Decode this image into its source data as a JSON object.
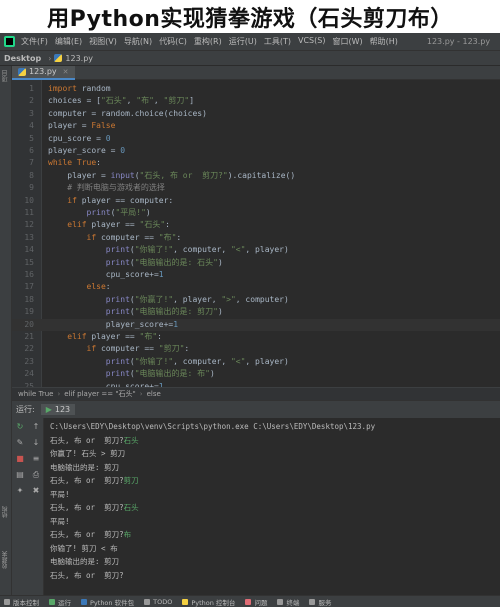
{
  "banner": {
    "title": "用Python实现猜拳游戏（石头剪刀布）"
  },
  "menubar": {
    "items": [
      "文件(F)",
      "编辑(E)",
      "视图(V)",
      "导航(N)",
      "代码(C)",
      "重构(R)",
      "运行(U)",
      "工具(T)",
      "VCS(S)",
      "窗口(W)",
      "帮助(H)"
    ],
    "window_title": "123.py - 123.py"
  },
  "navbar": {
    "root": "Desktop",
    "file": "123.py"
  },
  "editor": {
    "tab_label": "123.py",
    "current_line": 20,
    "lines": [
      [
        [
          "kw",
          "import "
        ],
        [
          "plain",
          "random"
        ]
      ],
      [
        [
          "plain",
          "choices = ["
        ],
        [
          "str",
          "\"石头\""
        ],
        [
          "plain",
          ", "
        ],
        [
          "str",
          "\"布\""
        ],
        [
          "plain",
          ", "
        ],
        [
          "str",
          "\"剪刀\""
        ],
        [
          "plain",
          "]"
        ]
      ],
      [
        [
          "plain",
          "computer = random.choice(choices)"
        ]
      ],
      [
        [
          "plain",
          "player = "
        ],
        [
          "kw",
          "False"
        ]
      ],
      [
        [
          "plain",
          "cpu_score = "
        ],
        [
          "num",
          "0"
        ]
      ],
      [
        [
          "plain",
          "player_score = "
        ],
        [
          "num",
          "0"
        ]
      ],
      [
        [
          "kw",
          "while "
        ],
        [
          "kw",
          "True"
        ],
        [
          "plain",
          ":"
        ]
      ],
      [
        [
          "plain",
          "    player = "
        ],
        [
          "fn",
          "input"
        ],
        [
          "plain",
          "("
        ],
        [
          "str",
          "\"石头, 布 or  剪刀?\""
        ],
        [
          "plain",
          ").capitalize()"
        ]
      ],
      [
        [
          "cmt",
          "    # 判断电脑与游戏者的选择"
        ]
      ],
      [
        [
          "kw",
          "    if "
        ],
        [
          "plain",
          "player == computer:"
        ]
      ],
      [
        [
          "plain",
          "        "
        ],
        [
          "fn",
          "print"
        ],
        [
          "plain",
          "("
        ],
        [
          "str",
          "\"平局!\""
        ],
        [
          "plain",
          ")"
        ]
      ],
      [
        [
          "kw",
          "    elif "
        ],
        [
          "plain",
          "player == "
        ],
        [
          "str",
          "\"石头\""
        ],
        [
          "plain",
          ":"
        ]
      ],
      [
        [
          "kw",
          "        if "
        ],
        [
          "plain",
          "computer == "
        ],
        [
          "str",
          "\"布\""
        ],
        [
          "plain",
          ":"
        ]
      ],
      [
        [
          "plain",
          "            "
        ],
        [
          "fn",
          "print"
        ],
        [
          "plain",
          "("
        ],
        [
          "str",
          "\"你输了!\""
        ],
        [
          "plain",
          ", computer, "
        ],
        [
          "str",
          "\"<\""
        ],
        [
          "plain",
          ", player)"
        ]
      ],
      [
        [
          "plain",
          "            "
        ],
        [
          "fn",
          "print"
        ],
        [
          "plain",
          "("
        ],
        [
          "str",
          "\"电脑输出的是: 石头\""
        ],
        [
          "plain",
          ")"
        ]
      ],
      [
        [
          "plain",
          "            cpu_score+="
        ],
        [
          "num",
          "1"
        ]
      ],
      [
        [
          "kw",
          "        else"
        ],
        [
          "plain",
          ":"
        ]
      ],
      [
        [
          "plain",
          "            "
        ],
        [
          "fn",
          "print"
        ],
        [
          "plain",
          "("
        ],
        [
          "str",
          "\"你赢了!\""
        ],
        [
          "plain",
          ", player, "
        ],
        [
          "str",
          "\">\""
        ],
        [
          "plain",
          ", computer)"
        ]
      ],
      [
        [
          "plain",
          "            "
        ],
        [
          "fn",
          "print"
        ],
        [
          "plain",
          "("
        ],
        [
          "str",
          "\"电脑输出的是: 剪刀\""
        ],
        [
          "plain",
          ")"
        ]
      ],
      [
        [
          "plain",
          "            player_score+="
        ],
        [
          "num",
          "1"
        ]
      ],
      [
        [
          "kw",
          "    elif "
        ],
        [
          "plain",
          "player == "
        ],
        [
          "str",
          "\"布\""
        ],
        [
          "plain",
          ":"
        ]
      ],
      [
        [
          "kw",
          "        if "
        ],
        [
          "plain",
          "computer == "
        ],
        [
          "str",
          "\"剪刀\""
        ],
        [
          "plain",
          ":"
        ]
      ],
      [
        [
          "plain",
          "            "
        ],
        [
          "fn",
          "print"
        ],
        [
          "plain",
          "("
        ],
        [
          "str",
          "\"你输了!\""
        ],
        [
          "plain",
          ", computer, "
        ],
        [
          "str",
          "\"<\""
        ],
        [
          "plain",
          ", player)"
        ]
      ],
      [
        [
          "plain",
          "            "
        ],
        [
          "fn",
          "print"
        ],
        [
          "plain",
          "("
        ],
        [
          "str",
          "\"电脑输出的是: 布\""
        ],
        [
          "plain",
          ")"
        ]
      ],
      [
        [
          "plain",
          "            cpu_score+="
        ],
        [
          "num",
          "1"
        ]
      ]
    ]
  },
  "breadcrumb": [
    "while True",
    "elif player == \"石头\"",
    "else"
  ],
  "run": {
    "label": "运行:",
    "tab_label": "123",
    "console": [
      {
        "text": "C:\\Users\\EDY\\Desktop\\venv\\Scripts\\python.exe C:\\Users\\EDY\\Desktop\\123.py",
        "input": ""
      },
      {
        "text": "石头, 布 or  剪刀?",
        "input": "石头"
      },
      {
        "text": "你赢了! 石头 > 剪刀",
        "input": ""
      },
      {
        "text": "电脑输出的是: 剪刀",
        "input": ""
      },
      {
        "text": "石头, 布 or  剪刀?",
        "input": "剪刀"
      },
      {
        "text": "平局!",
        "input": ""
      },
      {
        "text": "石头, 布 or  剪刀?",
        "input": "石头"
      },
      {
        "text": "平局!",
        "input": ""
      },
      {
        "text": "石头, 布 or  剪刀?",
        "input": "布"
      },
      {
        "text": "你输了! 剪刀 < 布",
        "input": ""
      },
      {
        "text": "电脑输出的是: 剪刀",
        "input": ""
      },
      {
        "text": "石头, 布 or  剪刀?",
        "input": ""
      }
    ]
  },
  "left_strip": {
    "label_top": "项目",
    "label_mid": "结构",
    "label_bottom": "收藏夹"
  },
  "bottombar": {
    "items": [
      {
        "label": "版本控制",
        "color": "#999999"
      },
      {
        "label": "运行",
        "color": "#59a869"
      },
      {
        "label": "Python 软件包",
        "color": "#3b78b8"
      },
      {
        "label": "TODO",
        "color": "#999999"
      },
      {
        "label": "Python 控制台",
        "color": "#f5d142"
      },
      {
        "label": "问题",
        "color": "#e06c75"
      },
      {
        "label": "终端",
        "color": "#999999"
      },
      {
        "label": "服务",
        "color": "#999999"
      }
    ]
  }
}
